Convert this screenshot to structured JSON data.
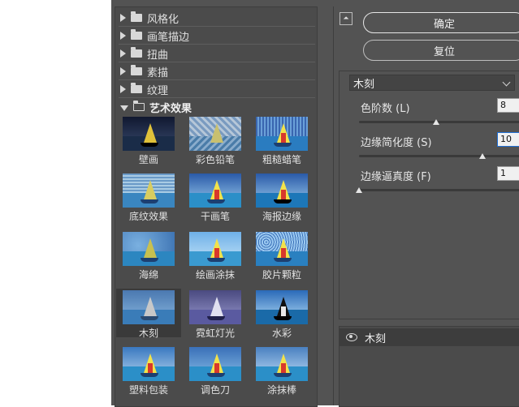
{
  "categories": [
    {
      "label": "风格化",
      "expanded": false
    },
    {
      "label": "画笔描边",
      "expanded": false
    },
    {
      "label": "扭曲",
      "expanded": false
    },
    {
      "label": "素描",
      "expanded": false
    },
    {
      "label": "纹理",
      "expanded": false
    },
    {
      "label": "艺术效果",
      "expanded": true
    }
  ],
  "filters": [
    {
      "label": "壁画"
    },
    {
      "label": "彩色铅笔"
    },
    {
      "label": "粗糙蜡笔"
    },
    {
      "label": "底纹效果"
    },
    {
      "label": "干画笔"
    },
    {
      "label": "海报边缘"
    },
    {
      "label": "海绵"
    },
    {
      "label": "绘画涂抹"
    },
    {
      "label": "胶片颗粒"
    },
    {
      "label": "木刻",
      "selected": true
    },
    {
      "label": "霓虹灯光"
    },
    {
      "label": "水彩"
    },
    {
      "label": "塑料包装"
    },
    {
      "label": "调色刀"
    },
    {
      "label": "涂抹棒"
    }
  ],
  "buttons": {
    "ok": "确定",
    "reset": "复位"
  },
  "filter_select": {
    "value": "木刻"
  },
  "params": [
    {
      "label": "色阶数 (L)",
      "value": "8",
      "slider_fraction": 0.5
    },
    {
      "label": "边缘简化度 (S)",
      "value": "10",
      "slider_fraction": 0.8
    },
    {
      "label": "边缘逼真度 (F)",
      "value": "1",
      "slider_fraction": 0.0
    }
  ],
  "layers": [
    {
      "label": "木刻",
      "visible": true
    }
  ],
  "colors": {
    "panel": "#535353",
    "dark": "#3d3d3d",
    "accent_focus": "#1f6fd6"
  }
}
